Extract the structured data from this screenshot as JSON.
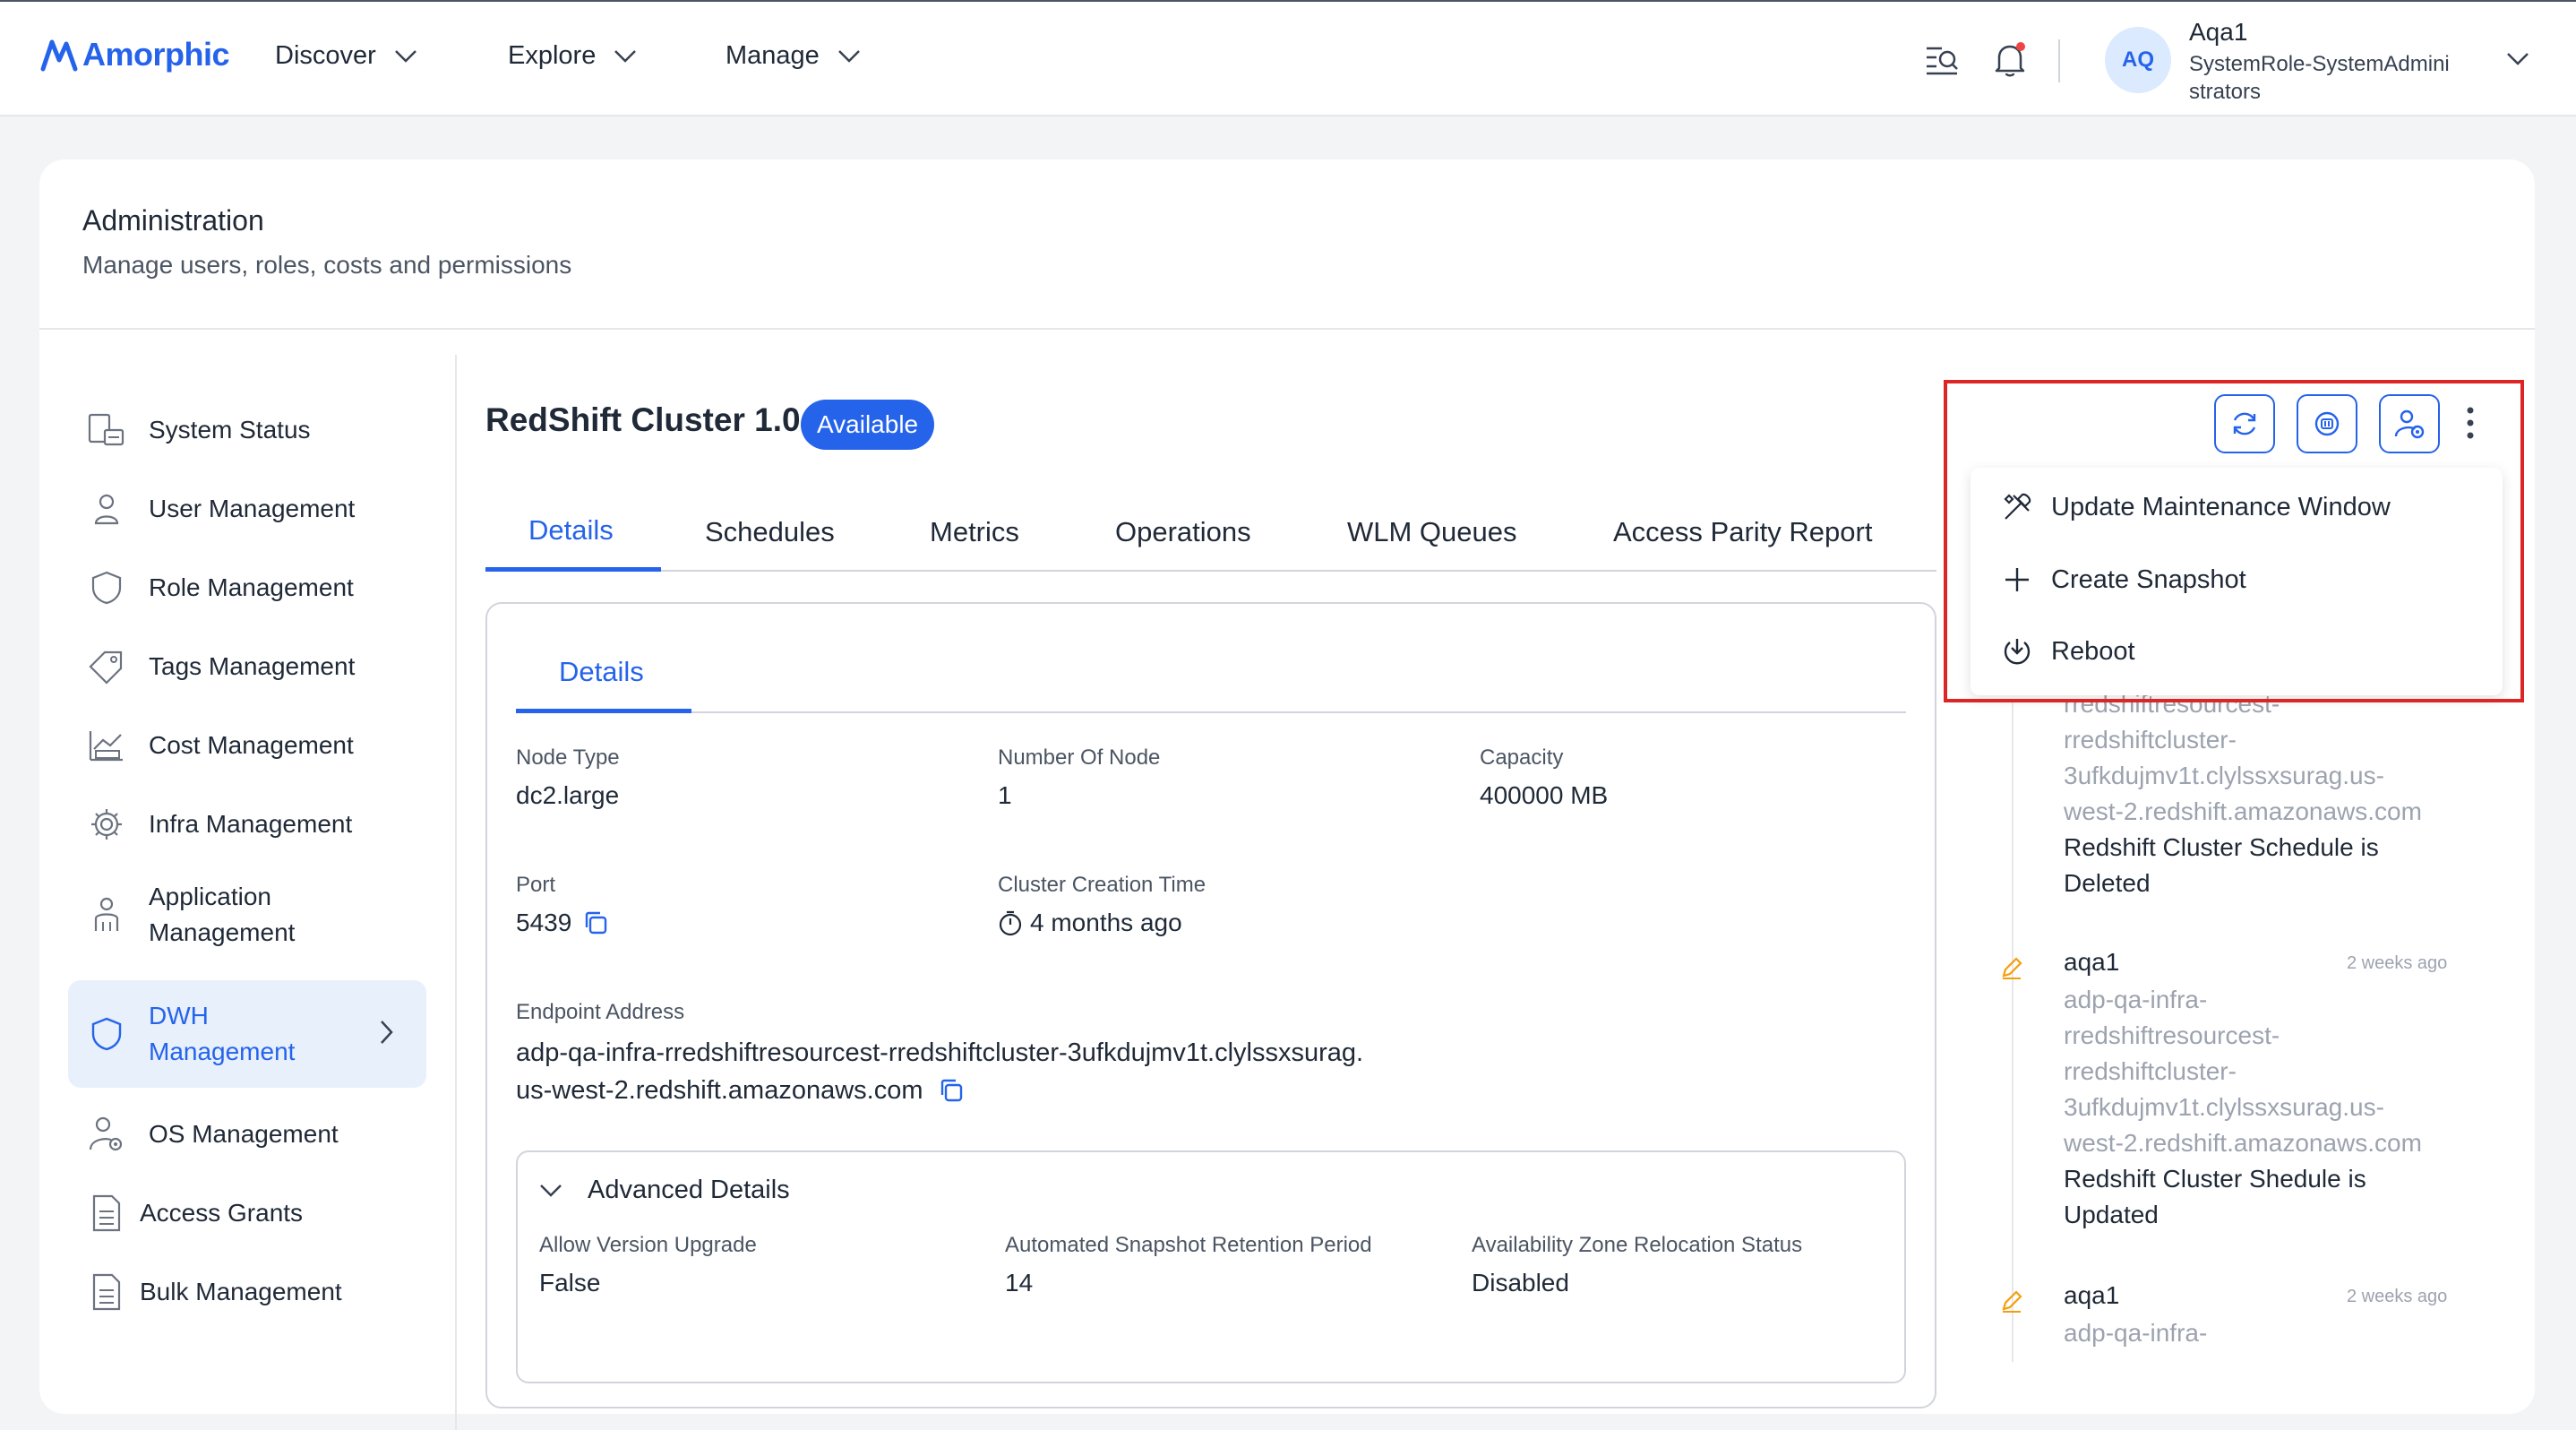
{
  "brand": {
    "name": "Amorphic",
    "color": "#2563eb"
  },
  "nav": {
    "items": [
      {
        "label": "Discover"
      },
      {
        "label": "Explore"
      },
      {
        "label": "Manage"
      }
    ]
  },
  "user": {
    "initials": "AQ",
    "name": "Aqa1",
    "role": "SystemRole-SystemAdministrators"
  },
  "page": {
    "title": "Administration",
    "subtitle": "Manage users, roles, costs and permissions"
  },
  "sidebar": {
    "items": [
      {
        "label": "System Status",
        "icon": "system-status-icon"
      },
      {
        "label": "User Management",
        "icon": "user-icon"
      },
      {
        "label": "Role Management",
        "icon": "shield-icon"
      },
      {
        "label": "Tags Management",
        "icon": "tag-icon"
      },
      {
        "label": "Cost Management",
        "icon": "cost-chart-icon"
      },
      {
        "label": "Infra Management",
        "icon": "gear-icon"
      },
      {
        "label": "Application Management",
        "icon": "application-user-icon"
      },
      {
        "label": "DWH Management",
        "icon": "shield-icon",
        "active": true
      },
      {
        "label": "OS Management",
        "icon": "os-user-gear-icon"
      },
      {
        "label": "Access Grants",
        "icon": "document-icon"
      },
      {
        "label": "Bulk Management",
        "icon": "document-icon"
      }
    ]
  },
  "cluster": {
    "title": "RedShift Cluster 1.0",
    "status": "Available",
    "status_color": "#2563eb"
  },
  "tabs": [
    {
      "label": "Details",
      "active": true
    },
    {
      "label": "Schedules"
    },
    {
      "label": "Metrics"
    },
    {
      "label": "Operations"
    },
    {
      "label": "WLM Queues"
    },
    {
      "label": "Access Parity Report"
    }
  ],
  "details": {
    "subtab": "Details",
    "node_type": {
      "label": "Node Type",
      "value": "dc2.large"
    },
    "num_nodes": {
      "label": "Number Of Node",
      "value": "1"
    },
    "capacity": {
      "label": "Capacity",
      "value": "400000 MB"
    },
    "port": {
      "label": "Port",
      "value": "5439"
    },
    "creation_time": {
      "label": "Cluster Creation Time",
      "value": "4 months ago"
    },
    "endpoint": {
      "label": "Endpoint Address",
      "line1": "adp-qa-infra-rredshiftresourcest-rredshiftcluster-3ufkdujmv1t.clylssxsurag.",
      "line2": "us-west-2.redshift.amazonaws.com"
    }
  },
  "advanced": {
    "title": "Advanced Details",
    "version_upgrade": {
      "label": "Allow Version Upgrade",
      "value": "False"
    },
    "snapshot_retention": {
      "label": "Automated Snapshot Retention Period",
      "value": "14"
    },
    "az_relocation": {
      "label": "Availability Zone Relocation Status",
      "value": "Disabled"
    }
  },
  "actions": {
    "buttons": [
      "refresh-icon",
      "pause-icon",
      "user-gear-icon"
    ],
    "menu": [
      {
        "label": "Update Maintenance Window",
        "icon": "tools-icon"
      },
      {
        "label": "Create Snapshot",
        "icon": "plus-icon"
      },
      {
        "label": "Reboot",
        "icon": "reboot-icon"
      }
    ]
  },
  "feed": [
    {
      "partial_lines": [
        "rredshiftresourcest-",
        "rredshiftcluster-",
        "3ufkdujmv1t.clylssxsurag.us-",
        "west-2.redshift.amazonaws.com"
      ],
      "message_lines": [
        "Redshift Cluster Schedule is",
        "Deleted"
      ]
    },
    {
      "user": "aqa1",
      "time": "2 weeks ago",
      "lines": [
        "adp-qa-infra-",
        "rredshiftresourcest-",
        "rredshiftcluster-",
        "3ufkdujmv1t.clylssxsurag.us-",
        "west-2.redshift.amazonaws.com"
      ],
      "message_lines": [
        "Redshift Cluster Shedule is",
        "Updated"
      ]
    },
    {
      "user": "aqa1",
      "time": "2 weeks ago",
      "lines": [
        "adp-qa-infra-"
      ]
    }
  ],
  "colors": {
    "accent": "#2563eb",
    "highlight": "#dc2626",
    "edit_icon": "#f59e0b",
    "notification_dot": "#ef4444"
  }
}
